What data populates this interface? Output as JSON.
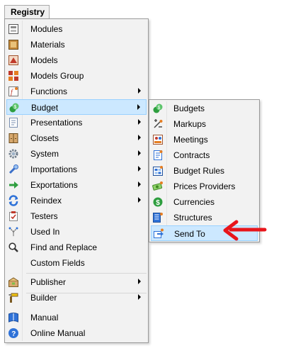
{
  "registry_tab": {
    "label": "Registry"
  },
  "main_menu": {
    "items": [
      {
        "label": "Modules",
        "icon": "modules-icon",
        "submenu": false
      },
      {
        "label": "Materials",
        "icon": "materials-icon",
        "submenu": false
      },
      {
        "label": "Models",
        "icon": "models-icon",
        "submenu": false
      },
      {
        "label": "Models Group",
        "icon": "models-group-icon",
        "submenu": false
      },
      {
        "label": "Functions",
        "icon": "functions-icon",
        "submenu": true
      },
      {
        "label": "Budget",
        "icon": "budget-icon",
        "submenu": true,
        "highlighted": true
      },
      {
        "label": "Presentations",
        "icon": "presentations-icon",
        "submenu": true
      },
      {
        "label": "Closets",
        "icon": "closets-icon",
        "submenu": true
      },
      {
        "label": "System",
        "icon": "system-gear-icon",
        "submenu": true
      },
      {
        "label": "Importations",
        "icon": "importations-icon",
        "submenu": true
      },
      {
        "label": "Exportations",
        "icon": "exportations-icon",
        "submenu": true
      },
      {
        "label": "Reindex",
        "icon": "reindex-icon",
        "submenu": true
      },
      {
        "label": "Testers",
        "icon": "testers-icon",
        "submenu": false
      },
      {
        "label": "Used In",
        "icon": "used-in-icon",
        "submenu": false
      },
      {
        "label": "Find and Replace",
        "icon": "magnifier-icon",
        "submenu": false
      },
      {
        "label": "Custom Fields",
        "icon": "",
        "submenu": false
      },
      {
        "label": "Publisher",
        "icon": "publisher-icon",
        "submenu": true
      },
      {
        "label": "Builder",
        "icon": "builder-icon",
        "submenu": true
      },
      {
        "label": "Manual",
        "icon": "manual-book-icon",
        "submenu": false
      },
      {
        "label": "Online Manual",
        "icon": "help-icon",
        "submenu": false
      }
    ]
  },
  "budget_submenu": {
    "items": [
      {
        "label": "Budgets",
        "icon": "budgets-icon"
      },
      {
        "label": "Markups",
        "icon": "markups-icon"
      },
      {
        "label": "Meetings",
        "icon": "meetings-icon"
      },
      {
        "label": "Contracts",
        "icon": "contracts-icon"
      },
      {
        "label": "Budget Rules",
        "icon": "budget-rules-icon"
      },
      {
        "label": "Prices Providers",
        "icon": "prices-providers-icon"
      },
      {
        "label": "Currencies",
        "icon": "currencies-icon"
      },
      {
        "label": "Structures",
        "icon": "structures-icon"
      },
      {
        "label": "Send To",
        "icon": "send-to-icon",
        "highlighted": true
      }
    ]
  },
  "colors": {
    "highlight_bg": "#cce8ff",
    "highlight_border": "#99d1ff",
    "menu_bg": "#f2f2f2",
    "annotation_arrow": "#e8151b"
  }
}
